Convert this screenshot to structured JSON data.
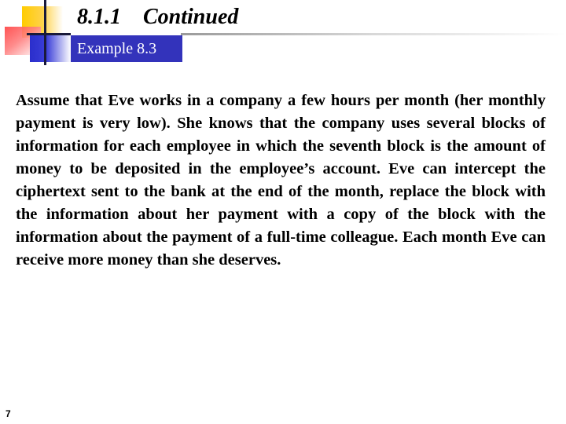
{
  "slide": {
    "section_title": "8.1.1    Continued",
    "example_label": "Example 8.3",
    "body": "Assume that Eve works in a company a few hours per month (her monthly payment is very low). She knows that the company uses several blocks of information for each employee in which the seventh block is the amount of money to be deposited in the employee’s account. Eve can intercept the ciphertext sent to the bank at the end of the month, replace the block with the information about her payment with a copy of the block with the information about the payment of a full-time colleague. Each month Eve can receive more money than she deserves.",
    "page_number": "7"
  },
  "colors": {
    "accent_yellow": "#ffcc00",
    "accent_red": "#ff4040",
    "accent_blue": "#3333bb"
  }
}
